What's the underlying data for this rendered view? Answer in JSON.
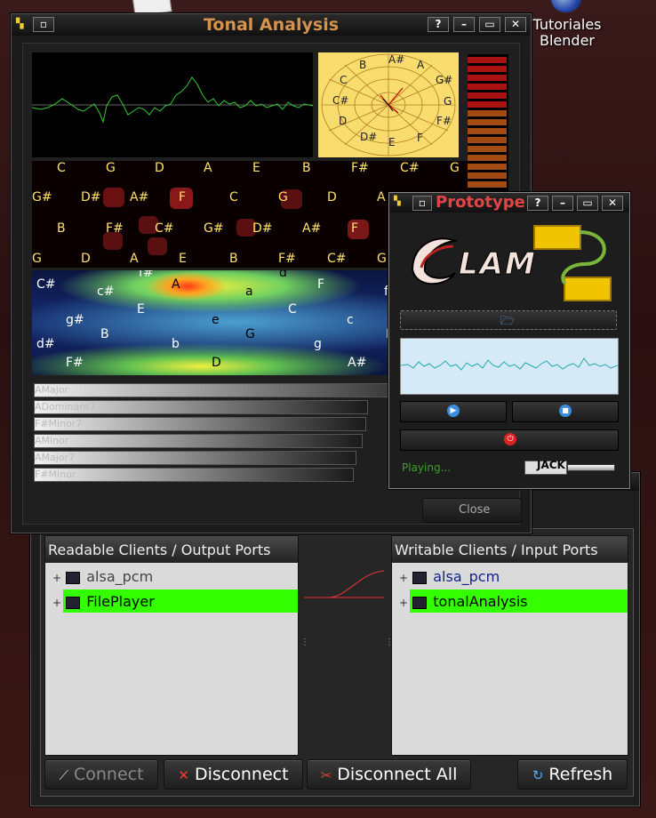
{
  "desktop": {
    "icon_label_line1": "Tutoriales",
    "icon_label_line2": "Blender"
  },
  "connector": {
    "readable_header": "Readable Clients / Output Ports",
    "writable_header": "Writable Clients / Input Ports",
    "readable_items": [
      "alsa_pcm",
      "FilePlayer"
    ],
    "writable_items": [
      "alsa_pcm",
      "tonalAnalysis"
    ],
    "connect_label": "Connect",
    "disconnect_label": "Disconnect",
    "disconnect_all_label": "Disconnect All",
    "refresh_label": "Refresh",
    "selected_color": "#33ff00"
  },
  "tonal": {
    "title": "Tonal Analysis",
    "help_button": "?",
    "close_label": "Close",
    "wheel_notes": [
      "A#",
      "A",
      "G#",
      "G",
      "F#",
      "F",
      "E",
      "D#",
      "D",
      "C#",
      "C",
      "B"
    ],
    "row1_notes": [
      "C",
      "G",
      "D",
      "A",
      "E",
      "B",
      "F#",
      "C#",
      "G"
    ],
    "row2_notes": [
      "G#",
      "D#",
      "A#",
      "F",
      "C",
      "G",
      "D",
      "A"
    ],
    "row3_notes": [
      "B",
      "F#",
      "C#",
      "G#",
      "D#",
      "A#",
      "F"
    ],
    "row4_notes": [
      "G",
      "D",
      "A",
      "E",
      "B",
      "F#",
      "C#",
      "G"
    ],
    "map_labels": [
      "C#",
      "c#",
      "f#",
      "A",
      "d",
      "F",
      "f",
      "E",
      "a",
      "C",
      "g#",
      "B",
      "e",
      "G",
      "c",
      "D",
      "d#",
      "b",
      "g",
      "F#",
      "D",
      "A#"
    ],
    "chords": [
      "AMajor",
      "ADominant7",
      "F#Minor7",
      "AMinor",
      "AMajor7",
      "F#Minor"
    ],
    "chord_strengths": [
      1.0,
      0.94,
      0.95,
      0.93,
      0.92,
      0.91
    ]
  },
  "prototype": {
    "title": "Prototype",
    "help_button": "?",
    "logo_text": "LAM",
    "status": "Playing...",
    "jack_label": "JACK"
  }
}
